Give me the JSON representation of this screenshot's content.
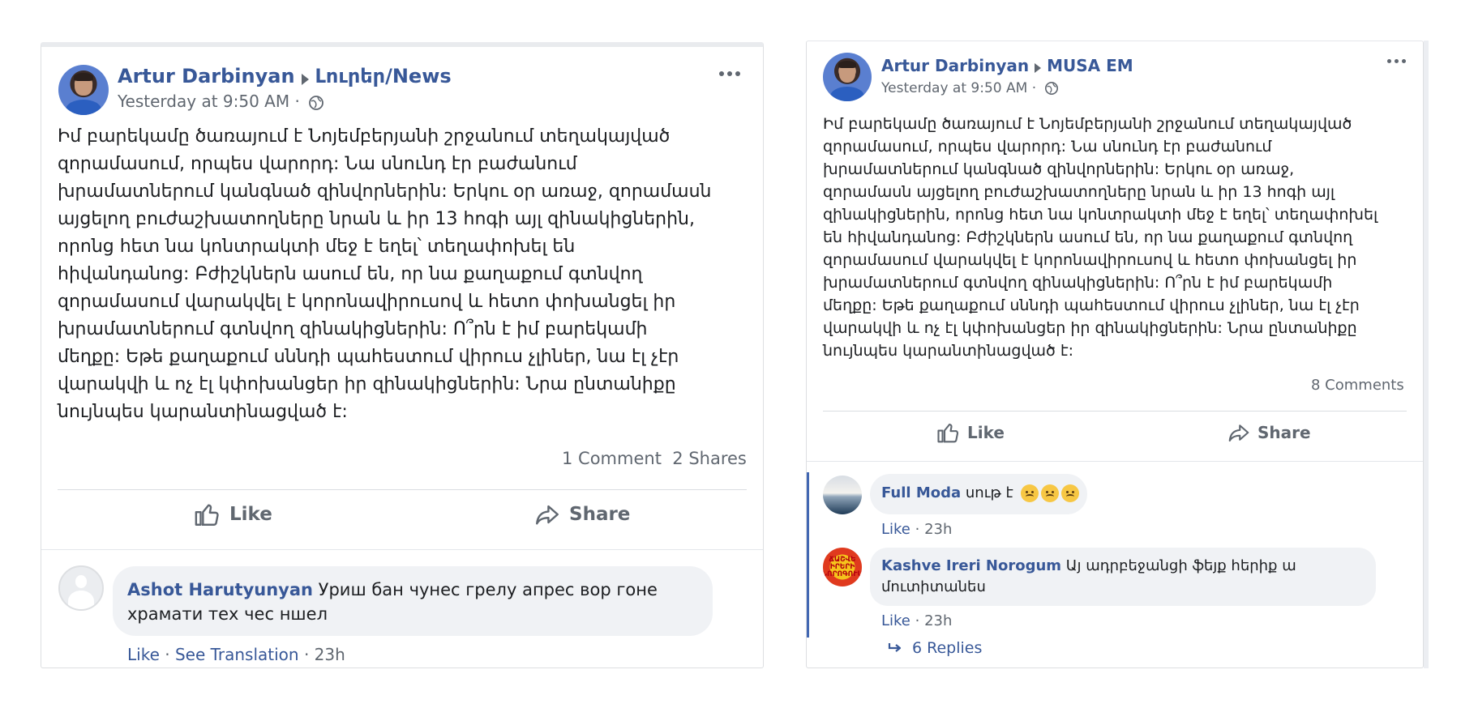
{
  "post_left": {
    "author": "Artur Darbinyan",
    "target": "Լուրեր/News",
    "time": "Yesterday at 9:50 AM",
    "separator": " · ",
    "text": "Իմ բարեկամը ծառայում է Նոյեմբերյանի շրջանում տեղակայված\nզորամասում, որպես վարորդ: Նա սնունդ էր բաժանում\nխրամատներում կանգնած զինվորներին: Երկու օր առաջ, զորամասն\nայցելող բուժաշխատողները նրան և իր 13 հոգի այլ զինակիցներին,\nորոնց հետ նա կոնտրակտի մեջ է եղել՝ տեղափոխել են\nհիվանդանոց: Բժիշկներն ասում են, որ նա քաղաքում գտնվող\nզորամասում վարակվել է կորոնավիրուսով և հետո փոխանցել իր\nխրամատներում գտնվող զինակիցներին: Ո՞րն է իմ բարեկամի\nմեղքը: Եթե քաղաքում սննդի պահեստում վիրուս չլիներ, նա էլ չէր\nվարակվի և ոչ էլ կփոխանցեր իր զինակիցներին: Նրա ընտանիքը\nնույնպես կարանտինացված է:",
    "comments_count": "1 Comment",
    "shares_count": "2 Shares",
    "like_label": "Like",
    "share_label": "Share",
    "comment": {
      "author": "Ashot Harutyunyan",
      "text_line1": "Уриш бан чунес грелу апрес вор гоне",
      "text_line2": "храмати тех чес ншел",
      "like": "Like",
      "translate": "See Translation",
      "time": "23h",
      "dot": " · "
    }
  },
  "post_right": {
    "author": "Artur Darbinyan",
    "target": "MUSA EM",
    "time": "Yesterday at 9:50 AM",
    "separator": " · ",
    "text": "Իմ բարեկամը ծառայում է Նոյեմբերյանի շրջանում տեղակայված\nզորամասում, որպես վարորդ: Նա սնունդ էր բաժանում\nխրամատներում կանգնած զինվորներին: Երկու օր առաջ,\nզորամասն այցելող բուժաշխատողները նրան և իր 13 հոգի այլ\nզինակիցներին, որոնց հետ նա կոնտրակտի մեջ է եղել՝ տեղափոխել\nեն հիվանդանոց: Բժիշկներն ասում են, որ նա քաղաքում գտնվող\nզորամասում վարակվել է կորոնավիրուսով և հետո փոխանցել իր\nխրամատներում գտնվող զինակիցներին: Ո՞րն է իմ բարեկամի\nմեղքը: Եթե քաղաքում սննդի պահեստում վիրուս չլիներ, նա էլ չէր\nվարակվի և ոչ էլ կփոխանցեր իր զինակիցներին: Նրա ընտանիքը\nնույնպես կարանտինացված է:",
    "comments_count": "8 Comments",
    "like_label": "Like",
    "share_label": "Share",
    "comments": [
      {
        "author": "Full Moda",
        "text": "սութ է",
        "like": "Like",
        "time": "23h",
        "dot": " · "
      },
      {
        "author": "Kashve Ireri Norogum",
        "text_line1": "Այ ադրբեջանցի ֆեյք հերիք ա",
        "text_line2": "մուտիտանես",
        "like": "Like",
        "time": "23h",
        "dot": " · "
      }
    ],
    "replies_label": "6 Replies",
    "logo_text": "ՃԱՇՎԵ\nԻՐԵՐԻ\nՆՈՐՈԳՈՒՄ"
  },
  "icons": [
    "globe-icon",
    "more-icon",
    "like-icon",
    "share-icon",
    "reply-arrow-icon",
    "angry-emoji-icon"
  ],
  "colors": {
    "link": "#385898",
    "muted": "#606770",
    "bubble": "#f0f2f5",
    "thread": "#4267b2"
  }
}
